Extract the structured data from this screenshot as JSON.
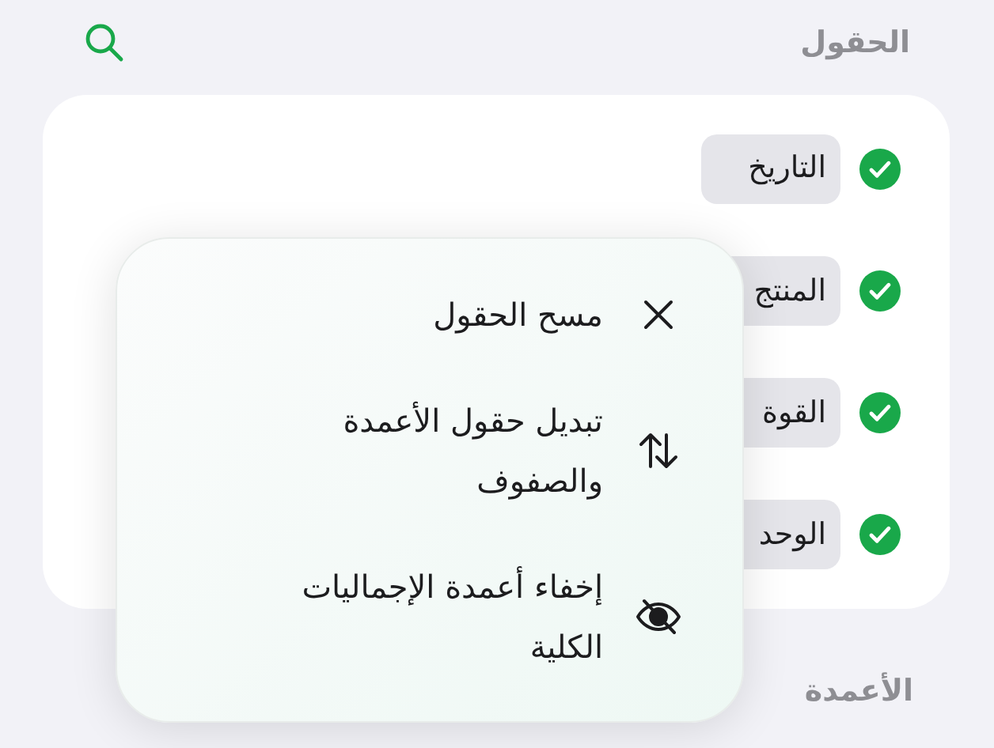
{
  "header": {
    "title": "الحقول"
  },
  "fields": [
    {
      "label": "التاريخ",
      "checked": true
    },
    {
      "label": "المنتج",
      "checked": true
    },
    {
      "label": "القوة",
      "checked": true
    },
    {
      "label": "الوحد",
      "checked": true
    }
  ],
  "menu": {
    "items": [
      {
        "kind": "clear",
        "label": "مسح الحقول"
      },
      {
        "kind": "swap",
        "label": "تبديل حقول الأعمدة والصفوف"
      },
      {
        "kind": "hide",
        "label": "إخفاء أعمدة الإجماليات الكلية"
      }
    ]
  },
  "columns_heading": "الأعمدة"
}
